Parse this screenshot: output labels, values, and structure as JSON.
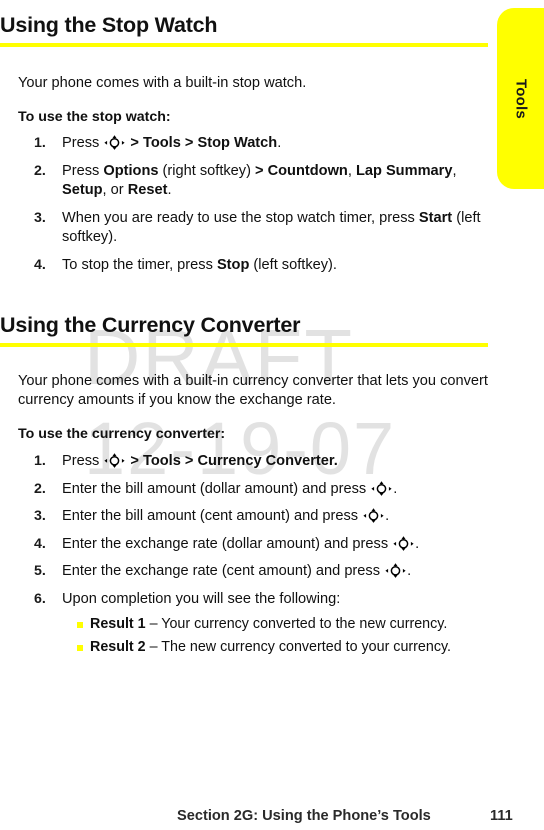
{
  "watermark": {
    "line1": "DRAFT",
    "line2": "12-19-07",
    "color": "#e2e2e2"
  },
  "side_tab": {
    "label": "Tools",
    "color": "#ffff00"
  },
  "accent_color": "#ffff00",
  "sections": [
    {
      "heading": "Using the Stop Watch",
      "intro": "Your phone comes with a built-in stop watch.",
      "lead_in": "To use the stop watch:",
      "steps": [
        {
          "number": "1.",
          "parts": [
            {
              "text": "Press ",
              "bold": false
            },
            {
              "icon": "navigation-key-icon"
            },
            {
              "text": " > ",
              "bold": true
            },
            {
              "text": "Tools",
              "bold": true
            },
            {
              "text": " > ",
              "bold": true
            },
            {
              "text": "Stop Watch",
              "bold": true
            },
            {
              "text": ".",
              "bold": false
            }
          ]
        },
        {
          "number": "2.",
          "parts": [
            {
              "text": "Press ",
              "bold": false
            },
            {
              "text": "Options",
              "bold": true
            },
            {
              "text": " (right softkey)",
              "bold": false
            },
            {
              "text": " > ",
              "bold": true
            },
            {
              "text": "Countdown",
              "bold": true
            },
            {
              "text": ", ",
              "bold": false
            },
            {
              "text": "Lap Summary",
              "bold": true
            },
            {
              "text": ", ",
              "bold": false
            },
            {
              "text": "Setup",
              "bold": true
            },
            {
              "text": ", or ",
              "bold": false
            },
            {
              "text": "Reset",
              "bold": true
            },
            {
              "text": ".",
              "bold": false
            }
          ]
        },
        {
          "number": "3.",
          "parts": [
            {
              "text": "When you are ready to use the stop watch timer, press ",
              "bold": false
            },
            {
              "text": "Start",
              "bold": true
            },
            {
              "text": " (left softkey).",
              "bold": false
            }
          ]
        },
        {
          "number": "4.",
          "parts": [
            {
              "text": "To stop the timer, press ",
              "bold": false
            },
            {
              "text": "Stop",
              "bold": true
            },
            {
              "text": " (left softkey).",
              "bold": false
            }
          ]
        }
      ]
    },
    {
      "heading": "Using the Currency Converter",
      "intro": "Your phone comes with a built-in currency converter that lets you convert currency amounts if you know the exchange rate.",
      "lead_in": "To use the currency converter:",
      "steps": [
        {
          "number": "1.",
          "parts": [
            {
              "text": "Press ",
              "bold": false
            },
            {
              "icon": "navigation-key-icon"
            },
            {
              "text": " > ",
              "bold": true
            },
            {
              "text": "Tools",
              "bold": true
            },
            {
              "text": " > ",
              "bold": true
            },
            {
              "text": "Currency Converter.",
              "bold": true
            }
          ]
        },
        {
          "number": "2.",
          "parts": [
            {
              "text": "Enter the bill amount (dollar amount) and press ",
              "bold": false
            },
            {
              "icon": "navigation-key-icon"
            },
            {
              "text": ".",
              "bold": false
            }
          ]
        },
        {
          "number": "3.",
          "parts": [
            {
              "text": "Enter the bill amount (cent amount) and press ",
              "bold": false
            },
            {
              "icon": "navigation-key-icon"
            },
            {
              "text": ".",
              "bold": false
            }
          ]
        },
        {
          "number": "4.",
          "parts": [
            {
              "text": "Enter the exchange rate (dollar amount) and press ",
              "bold": false
            },
            {
              "icon": "navigation-key-icon"
            },
            {
              "text": ".",
              "bold": false
            }
          ]
        },
        {
          "number": "5.",
          "parts": [
            {
              "text": "Enter the exchange rate (cent amount) and press ",
              "bold": false
            },
            {
              "icon": "navigation-key-icon"
            },
            {
              "text": ".",
              "bold": false
            }
          ]
        },
        {
          "number": "6.",
          "parts": [
            {
              "text": "Upon completion you will see the following:",
              "bold": false
            }
          ],
          "sub_bullets": [
            {
              "parts": [
                {
                  "text": "Result 1",
                  "bold": true
                },
                {
                  "text": " – Your currency converted to the new currency.",
                  "bold": false
                }
              ]
            },
            {
              "parts": [
                {
                  "text": "Result 2",
                  "bold": true
                },
                {
                  "text": " – The new currency converted to your currency.",
                  "bold": false
                }
              ]
            }
          ]
        }
      ]
    }
  ],
  "footer": {
    "title": "Section 2G: Using the Phone’s Tools",
    "page": "111"
  }
}
